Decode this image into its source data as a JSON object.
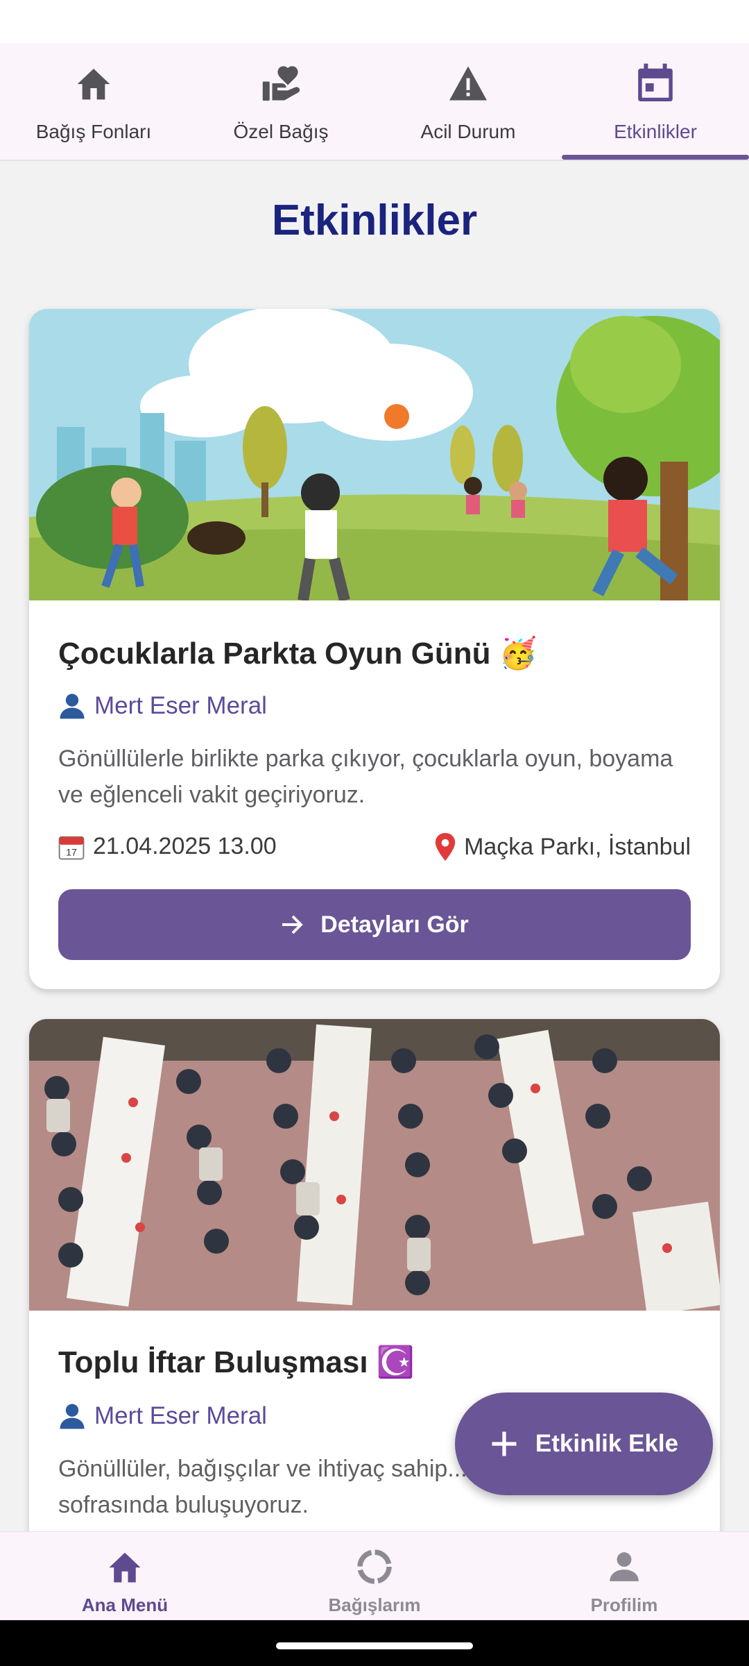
{
  "top_tabs": [
    {
      "label": "Bağış Fonları",
      "icon": "home-icon"
    },
    {
      "label": "Özel Bağış",
      "icon": "volunteer-hand-heart-icon"
    },
    {
      "label": "Acil Durum",
      "icon": "warning-icon"
    },
    {
      "label": "Etkinlikler",
      "icon": "calendar-icon",
      "active": true
    }
  ],
  "page": {
    "title": "Etkinlikler"
  },
  "events": [
    {
      "title": "Çocuklarla Parkta Oyun Günü 🥳",
      "author": "Mert Eser Meral",
      "description": "Gönüllülerle birlikte parka çıkıyor, çocuklarla oyun, boyama ve eğlenceli vakit geçiriyoruz.",
      "date": "21.04.2025 13.00",
      "location": "Maçka Parkı, İstanbul",
      "button_label": "Detayları Gör",
      "image": "children-playing-in-park-illustration"
    },
    {
      "title": "Toplu İftar Buluşması ☪️",
      "author": "Mert Eser Meral",
      "description": "Gönüllüler, bağışçılar ve ihtiyaç sahip... büyük bir iftar sofrasında buluşuyoruz.",
      "image": "community-iftar-tables-photo"
    }
  ],
  "fab": {
    "label": "Etkinlik Ekle",
    "icon": "plus-icon"
  },
  "bottom_nav": [
    {
      "label": "Ana Menü",
      "icon": "home-icon",
      "active": true
    },
    {
      "label": "Bağışlarım",
      "icon": "progress-ring-icon"
    },
    {
      "label": "Profilim",
      "icon": "person-icon"
    }
  ],
  "colors": {
    "primary": "#6a5596",
    "title_navy": "#1a237e",
    "author_purple": "#5b4a9a",
    "tab_bar_bg": "#fbf4fb",
    "page_bg": "#f2f2f3"
  }
}
